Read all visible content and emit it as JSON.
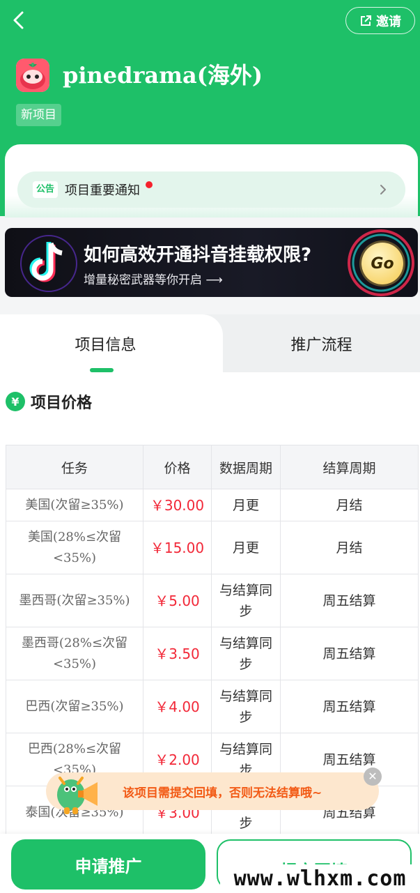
{
  "header": {
    "invite_label": "邀请",
    "app_title": "pinedrama(海外)",
    "tag": "新项目"
  },
  "notice": {
    "badge": "公告",
    "text": "项目重要通知"
  },
  "banner": {
    "title": "如何高效开通抖音挂载权限?",
    "subtitle": "增量秘密武器等你开启 ⟶",
    "go_label": "Go"
  },
  "tabs": [
    {
      "label": "项目信息",
      "active": true
    },
    {
      "label": "推广流程",
      "active": false
    }
  ],
  "section": {
    "title": "项目价格",
    "icon_glyph": "¥"
  },
  "table": {
    "headers": [
      "任务",
      "价格",
      "数据周期",
      "结算周期"
    ],
    "rows": [
      {
        "task": "美国(次留≥35%)",
        "price": "￥30.00",
        "data_cycle": "月更",
        "settle_cycle": "月结"
      },
      {
        "task": "美国(28%≤次留<35%)",
        "price": "￥15.00",
        "data_cycle": "月更",
        "settle_cycle": "月结"
      },
      {
        "task": "墨西哥(次留≥35%)",
        "price": "￥5.00",
        "data_cycle": "与结算同步",
        "settle_cycle": "周五结算"
      },
      {
        "task": "墨西哥(28%≤次留<35%)",
        "price": "￥3.50",
        "data_cycle": "与结算同步",
        "settle_cycle": "周五结算"
      },
      {
        "task": "巴西(次留≥35%)",
        "price": "￥4.00",
        "data_cycle": "与结算同步",
        "settle_cycle": "周五结算"
      },
      {
        "task": "巴西(28%≤次留<35%)",
        "price": "￥2.00",
        "data_cycle": "与结算同步",
        "settle_cycle": "周五结算"
      },
      {
        "task": "泰国(次留≥35%)",
        "price": "￥3.00",
        "data_cycle": "与结算同步",
        "settle_cycle": "周五结算"
      }
    ]
  },
  "toast": {
    "text": "该项目需提交回填，否则无法结算哦~"
  },
  "bottom": {
    "apply_label": "申请推广",
    "submit_label": "提交回填"
  },
  "watermark": "www.wlhxm.com",
  "colors": {
    "brand": "#1ec068",
    "price": "#f22838",
    "toast_text": "#f25a15",
    "notice_dot": "#f5222d"
  }
}
